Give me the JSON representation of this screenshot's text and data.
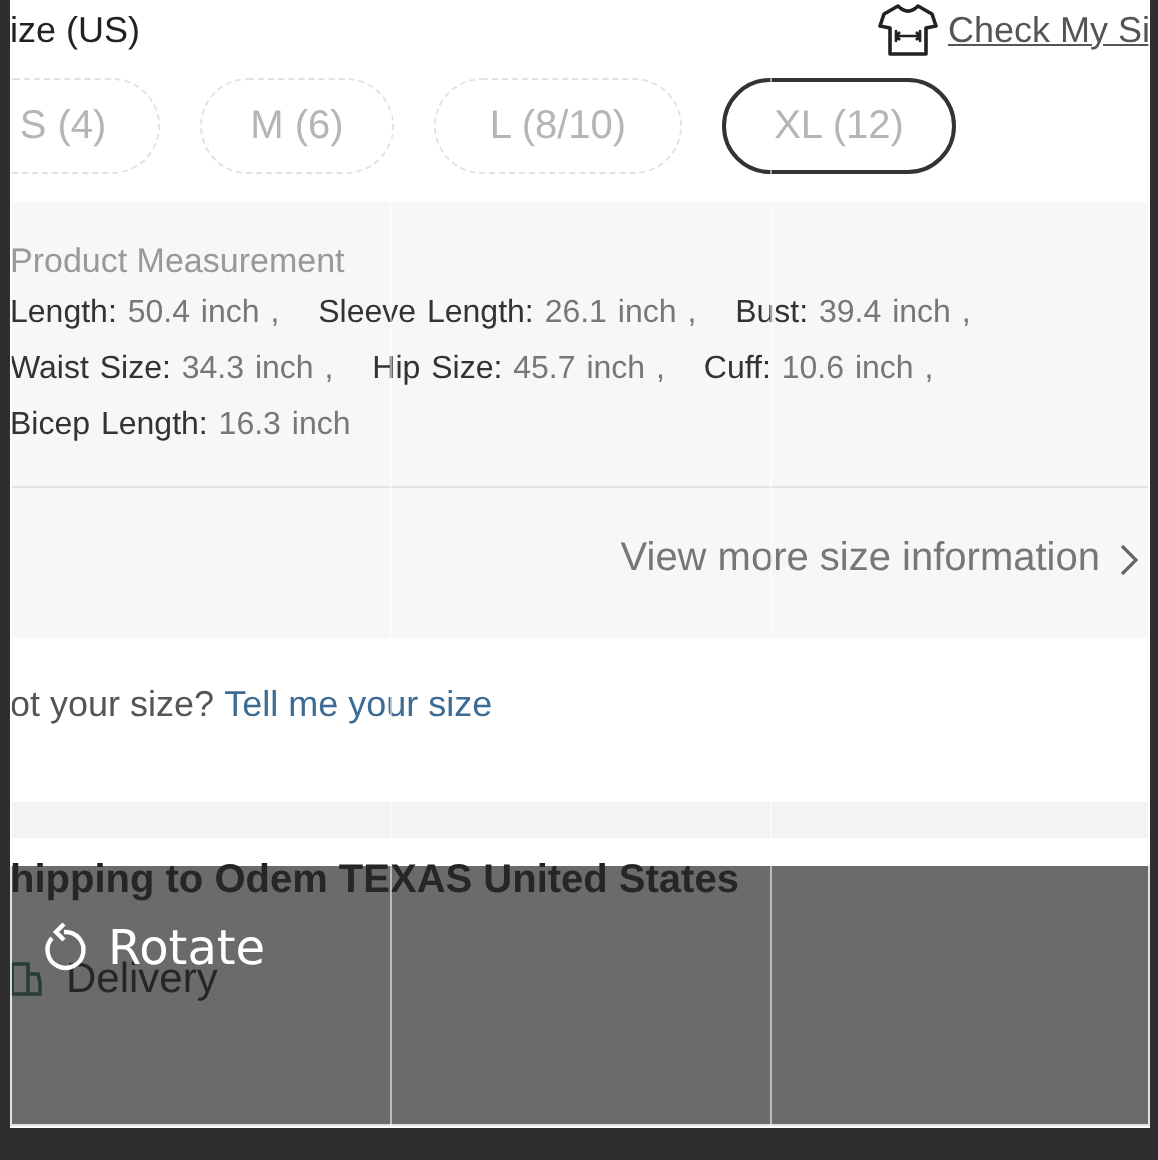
{
  "header": {
    "title": "ize (US)",
    "check_link": "Check My Si"
  },
  "sizes": [
    {
      "label": "S (4)",
      "selected": false
    },
    {
      "label": "M (6)",
      "selected": false
    },
    {
      "label": "L (8/10)",
      "selected": false
    },
    {
      "label": "XL (12)",
      "selected": true
    }
  ],
  "measurement": {
    "title": "Product Measurement",
    "items": [
      {
        "label": "Length:",
        "value": "50.4 inch ,"
      },
      {
        "label": "Sleeve Length:",
        "value": "26.1 inch ,"
      },
      {
        "label": "Bust:",
        "value": "39.4 inch ,"
      },
      {
        "label": "Waist Size:",
        "value": "34.3 inch ,"
      },
      {
        "label": "Hip Size:",
        "value": "45.7 inch ,"
      },
      {
        "label": "Cuff:",
        "value": "10.6 inch ,"
      },
      {
        "label": "Bicep Length:",
        "value": "16.3 inch"
      }
    ]
  },
  "more_link": "View more size information",
  "fit_prompt": {
    "text": "ot your size?",
    "link": "Tell me your size"
  },
  "shipping": {
    "title": "hipping to Odem TEXAS United States",
    "delivery": "Delivery"
  },
  "editor": {
    "rotate": "Rotate"
  }
}
